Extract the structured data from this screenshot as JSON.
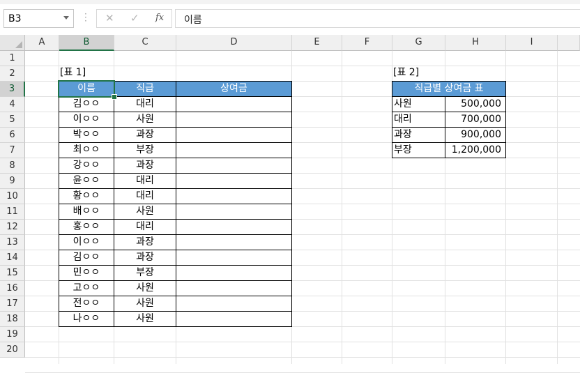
{
  "formula_bar": {
    "name_box": "B3",
    "cancel_icon": "✕",
    "enter_icon": "✓",
    "fx_icon": "fx",
    "formula_value": "이름"
  },
  "columns": [
    "A",
    "B",
    "C",
    "D",
    "E",
    "F",
    "G",
    "H",
    "I"
  ],
  "rows": [
    "1",
    "2",
    "3",
    "4",
    "5",
    "6",
    "7",
    "8",
    "9",
    "10",
    "11",
    "12",
    "13",
    "14",
    "15",
    "16",
    "17",
    "18",
    "19",
    "20"
  ],
  "selected_cell": "B3",
  "table1": {
    "label": "[표 1]",
    "headers": [
      "이름",
      "직급",
      "상여금"
    ],
    "rows": [
      [
        "김ㅇㅇ",
        "대리",
        ""
      ],
      [
        "이ㅇㅇ",
        "사원",
        ""
      ],
      [
        "박ㅇㅇ",
        "과장",
        ""
      ],
      [
        "최ㅇㅇ",
        "부장",
        ""
      ],
      [
        "강ㅇㅇ",
        "과장",
        ""
      ],
      [
        "윤ㅇㅇ",
        "대리",
        ""
      ],
      [
        "황ㅇㅇ",
        "대리",
        ""
      ],
      [
        "배ㅇㅇ",
        "사원",
        ""
      ],
      [
        "홍ㅇㅇ",
        "대리",
        ""
      ],
      [
        "이ㅇㅇ",
        "과장",
        ""
      ],
      [
        "김ㅇㅇ",
        "과장",
        ""
      ],
      [
        "민ㅇㅇ",
        "부장",
        ""
      ],
      [
        "고ㅇㅇ",
        "사원",
        ""
      ],
      [
        "전ㅇㅇ",
        "사원",
        ""
      ],
      [
        "나ㅇㅇ",
        "사원",
        ""
      ]
    ]
  },
  "table2": {
    "label": "[표 2]",
    "title": "직급별 상여금 표",
    "rows": [
      [
        "사원",
        "500,000"
      ],
      [
        "대리",
        "700,000"
      ],
      [
        "과장",
        "900,000"
      ],
      [
        "부장",
        "1,200,000"
      ]
    ]
  },
  "colors": {
    "header_fill": "#5b9bd5",
    "selection": "#217346"
  }
}
